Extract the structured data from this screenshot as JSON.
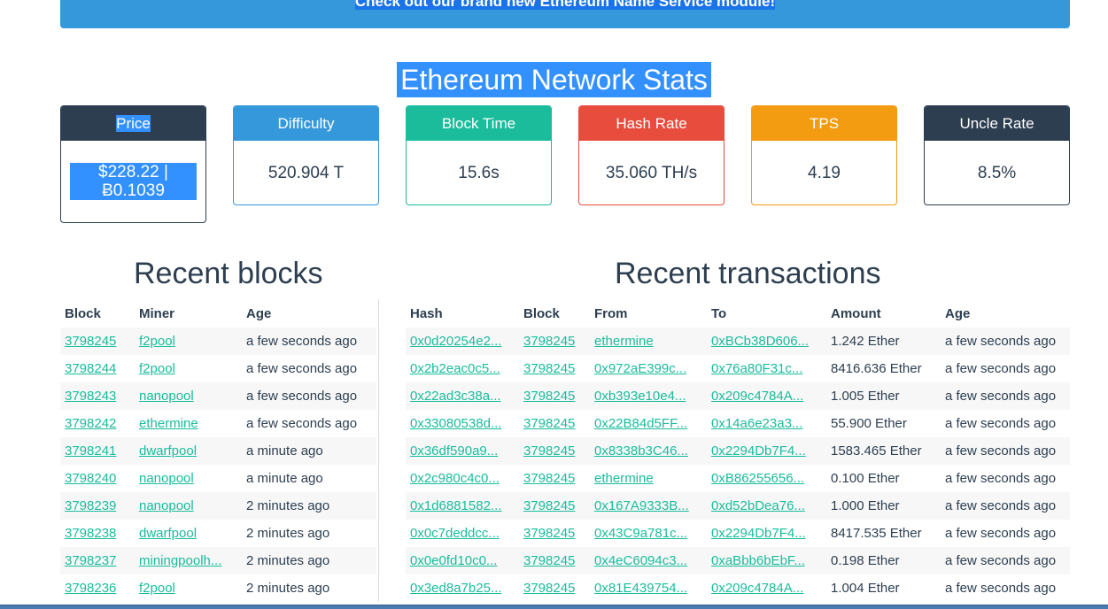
{
  "banner": {
    "text": "Check out our brand new Ethereum Name Service module!"
  },
  "page_title": "Ethereum Network Stats",
  "colors": {
    "dark": "#2c3e50",
    "blue": "#3498db",
    "green": "#1abc9c",
    "red": "#e74c3c",
    "orange": "#f39c12",
    "link": "#1abc9c"
  },
  "stats": [
    {
      "label": "Price",
      "value": "$228.22 | Ƀ0.1039",
      "color": "#2c3e50"
    },
    {
      "label": "Difficulty",
      "value": "520.904 T",
      "color": "#3498db"
    },
    {
      "label": "Block Time",
      "value": "15.6s",
      "color": "#1abc9c"
    },
    {
      "label": "Hash Rate",
      "value": "35.060 TH/s",
      "color": "#e74c3c"
    },
    {
      "label": "TPS",
      "value": "4.19",
      "color": "#f39c12"
    },
    {
      "label": "Uncle Rate",
      "value": "8.5%",
      "color": "#2c3e50"
    }
  ],
  "recent_blocks": {
    "title": "Recent blocks",
    "columns": [
      "Block",
      "Miner",
      "Age"
    ],
    "rows": [
      {
        "block": "3798245",
        "miner": "f2pool",
        "age": "a few seconds ago"
      },
      {
        "block": "3798244",
        "miner": "f2pool",
        "age": "a few seconds ago"
      },
      {
        "block": "3798243",
        "miner": "nanopool",
        "age": "a few seconds ago"
      },
      {
        "block": "3798242",
        "miner": "ethermine",
        "age": "a few seconds ago"
      },
      {
        "block": "3798241",
        "miner": "dwarfpool",
        "age": "a minute ago"
      },
      {
        "block": "3798240",
        "miner": "nanopool",
        "age": "a minute ago"
      },
      {
        "block": "3798239",
        "miner": "nanopool",
        "age": "2 minutes ago"
      },
      {
        "block": "3798238",
        "miner": "dwarfpool",
        "age": "2 minutes ago"
      },
      {
        "block": "3798237",
        "miner": "miningpoolh...",
        "age": "2 minutes ago"
      },
      {
        "block": "3798236",
        "miner": "f2pool",
        "age": "2 minutes ago"
      }
    ]
  },
  "recent_transactions": {
    "title": "Recent transactions",
    "columns": [
      "Hash",
      "Block",
      "From",
      "To",
      "Amount",
      "Age"
    ],
    "rows": [
      {
        "hash": "0x0d20254e2...",
        "block": "3798245",
        "from": "ethermine",
        "to": "0xBCb38D606...",
        "amount": "1.242 Ether",
        "age": "a few seconds ago"
      },
      {
        "hash": "0x2b2eac0c5...",
        "block": "3798245",
        "from": "0x972aE399c...",
        "to": "0x76a80F31c...",
        "amount": "8416.636 Ether",
        "age": "a few seconds ago"
      },
      {
        "hash": "0x22ad3c38a...",
        "block": "3798245",
        "from": "0xb393e10e4...",
        "to": "0x209c4784A...",
        "amount": "1.005 Ether",
        "age": "a few seconds ago"
      },
      {
        "hash": "0x33080538d...",
        "block": "3798245",
        "from": "0x22B84d5FF...",
        "to": "0x14a6e23a3...",
        "amount": "55.900 Ether",
        "age": "a few seconds ago"
      },
      {
        "hash": "0x36df590a9...",
        "block": "3798245",
        "from": "0x8338b3C46...",
        "to": "0x2294Db7F4...",
        "amount": "1583.465 Ether",
        "age": "a few seconds ago"
      },
      {
        "hash": "0x2c980c4c0...",
        "block": "3798245",
        "from": "ethermine",
        "to": "0xB86255656...",
        "amount": "0.100 Ether",
        "age": "a few seconds ago"
      },
      {
        "hash": "0x1d6881582...",
        "block": "3798245",
        "from": "0x167A9333B...",
        "to": "0xd52bDea76...",
        "amount": "1.000 Ether",
        "age": "a few seconds ago"
      },
      {
        "hash": "0x0c7deddcc...",
        "block": "3798245",
        "from": "0x43C9a781c...",
        "to": "0x2294Db7F4...",
        "amount": "8417.535 Ether",
        "age": "a few seconds ago"
      },
      {
        "hash": "0x0e0fd10c0...",
        "block": "3798245",
        "from": "0x4eC6094c3...",
        "to": "0xaBbb6bEbF...",
        "amount": "0.198 Ether",
        "age": "a few seconds ago"
      },
      {
        "hash": "0x3ed8a7b25...",
        "block": "3798245",
        "from": "0x81E439754...",
        "to": "0x209c4784A...",
        "amount": "1.004 Ether",
        "age": "a few seconds ago"
      }
    ]
  }
}
